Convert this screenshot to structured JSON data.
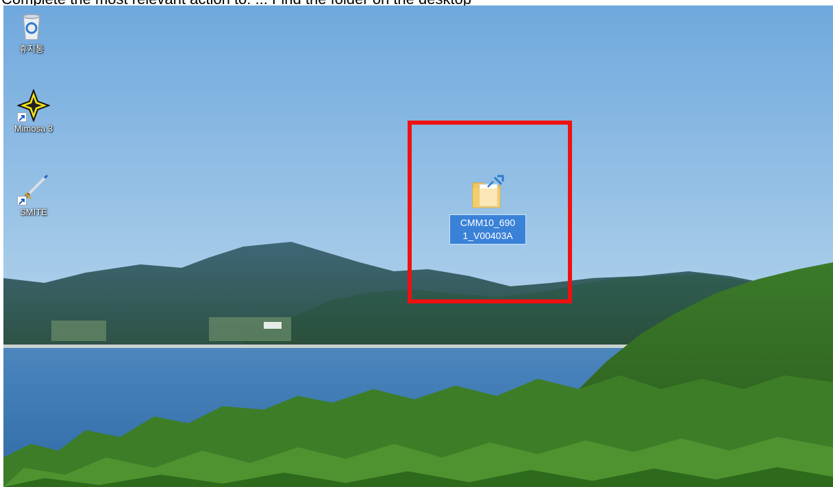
{
  "caption": "Complete the most relevant action to: ... Find the folder on the desktop",
  "desktop": {
    "icons": [
      {
        "label": "휴지통",
        "icon": "recycle-bin-icon"
      },
      {
        "label": "Mimosa 3",
        "icon": "mimosa-compass-icon"
      },
      {
        "label": "SMITE",
        "icon": "smite-sword-icon"
      }
    ],
    "selected_folder": {
      "name_line1": "CMM10_690",
      "name_line2": "1_V00403A",
      "icon": "folder-shortcut-icon"
    }
  },
  "colors": {
    "sky_top": "#74aee0",
    "sky_bottom": "#b9d8ee",
    "sea": "#3f78b3",
    "highlight": "#ee1111",
    "selection": "#3a82d8"
  }
}
